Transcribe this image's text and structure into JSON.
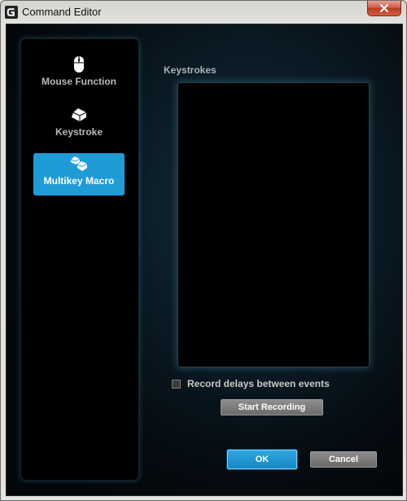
{
  "window": {
    "title": "Command Editor",
    "logo_icon": "logitech-g-icon",
    "close_icon": "close-icon"
  },
  "nav": {
    "items": [
      {
        "label": "Mouse Function",
        "icon": "mouse-icon",
        "active": false
      },
      {
        "label": "Keystroke",
        "icon": "key-icon",
        "active": false
      },
      {
        "label": "Multikey Macro",
        "icon": "multikey-icon",
        "active": true
      }
    ]
  },
  "keystrokes": {
    "label": "Keystrokes",
    "items": []
  },
  "options": {
    "record_delays_label": "Record delays between events",
    "record_delays_checked": false,
    "start_recording_label": "Start Recording"
  },
  "footer": {
    "ok_label": "OK",
    "cancel_label": "Cancel"
  },
  "colors": {
    "accent": "#1f9bd6",
    "background": "#050b10"
  }
}
